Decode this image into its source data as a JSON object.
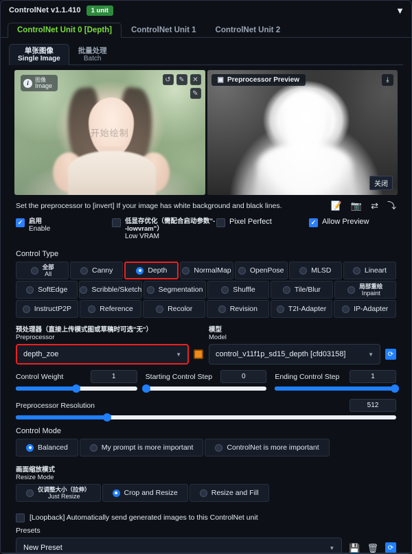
{
  "header": {
    "title": "ControlNet v1.1.410",
    "unit_badge": "1 unit",
    "collapse_icon": "▼"
  },
  "tabs": [
    {
      "label": "ControlNet Unit 0 [Depth]",
      "active": true
    },
    {
      "label": "ControlNet Unit 1",
      "active": false
    },
    {
      "label": "ControlNet Unit 2",
      "active": false
    }
  ],
  "subtabs": [
    {
      "cn": "单张图像",
      "en": "Single Image",
      "active": true
    },
    {
      "cn": "批量处理",
      "en": "Batch",
      "active": false
    }
  ],
  "image_panel": {
    "badge_cn": "图像",
    "badge_en": "Image",
    "info_icon": "i",
    "watermark": "开始绘制",
    "tools": [
      {
        "name": "undo-icon",
        "glyph": "↺"
      },
      {
        "name": "erase-icon",
        "glyph": "✎"
      },
      {
        "name": "close-icon",
        "glyph": "✕"
      }
    ],
    "edit_tool": {
      "name": "draw-icon",
      "glyph": "✎"
    }
  },
  "preview_panel": {
    "label": "Preprocessor Preview",
    "label_icon": "▣",
    "download_icon": "⤓",
    "close_label": "关闭"
  },
  "hint": {
    "text": "Set the preprocessor to [invert] If your image has white background and black lines.",
    "icons": [
      {
        "name": "edit-note-icon",
        "glyph": "📝"
      },
      {
        "name": "camera-icon",
        "glyph": "📷"
      },
      {
        "name": "swap-icon",
        "glyph": "⇄"
      },
      {
        "name": "send-arrow-icon",
        "glyph": "⤵"
      }
    ]
  },
  "checkboxes": {
    "enable": {
      "cn": "启用",
      "en": "Enable",
      "checked": true
    },
    "low_vram": {
      "cn": "低显存优化（需配合启动参数\"--lowvram\"）",
      "en": "Low VRAM",
      "checked": false
    },
    "pixel_perfect": {
      "label": "Pixel Perfect",
      "checked": false
    },
    "allow_preview": {
      "label": "Allow Preview",
      "checked": true
    }
  },
  "control_type": {
    "label": "Control Type",
    "rows": [
      [
        {
          "cn": "全部",
          "en": "All",
          "selected": false
        },
        {
          "label": "Canny",
          "selected": false
        },
        {
          "label": "Depth",
          "selected": true,
          "highlight": true
        },
        {
          "label": "NormalMap",
          "selected": false
        },
        {
          "label": "OpenPose",
          "selected": false
        },
        {
          "label": "MLSD",
          "selected": false
        },
        {
          "label": "Lineart",
          "selected": false
        }
      ],
      [
        {
          "label": "SoftEdge",
          "selected": false
        },
        {
          "label": "Scribble/Sketch",
          "selected": false
        },
        {
          "label": "Segmentation",
          "selected": false
        },
        {
          "label": "Shuffle",
          "selected": false
        },
        {
          "label": "Tile/Blur",
          "selected": false
        },
        {
          "cn": "局部重绘",
          "en": "Inpaint",
          "selected": false
        }
      ],
      [
        {
          "label": "InstructP2P",
          "selected": false
        },
        {
          "label": "Reference",
          "selected": false
        },
        {
          "label": "Recolor",
          "selected": false
        },
        {
          "label": "Revision",
          "selected": false
        },
        {
          "label": "T2I-Adapter",
          "selected": false
        },
        {
          "label": "IP-Adapter",
          "selected": false
        }
      ]
    ]
  },
  "preprocessor": {
    "label_cn": "预处理器（直接上传模式图或草稿时可选\"无\"）",
    "label_en": "Preprocessor",
    "value": "depth_zoe",
    "caret": "▼",
    "action_icon": "orange-square-icon"
  },
  "model": {
    "label_cn": "模型",
    "label_en": "Model",
    "value": "control_v11f1p_sd15_depth [cfd03158]",
    "caret": "▼",
    "refresh_icon": "⟳"
  },
  "sliders": [
    {
      "name": "Control Weight",
      "value": "1",
      "percent": 50
    },
    {
      "name": "Starting Control Step",
      "value": "0",
      "percent": 0
    },
    {
      "name": "Ending Control Step",
      "value": "1",
      "percent": 100
    }
  ],
  "resolution_slider": {
    "name": "Preprocessor Resolution",
    "value": "512",
    "percent": 24
  },
  "control_mode": {
    "label": "Control Mode",
    "options": [
      {
        "label": "Balanced",
        "selected": true
      },
      {
        "label": "My prompt is more important",
        "selected": false
      },
      {
        "label": "ControlNet is more important",
        "selected": false
      }
    ]
  },
  "resize_mode": {
    "label_cn": "画面缩放模式",
    "label_en": "Resize Mode",
    "options": [
      {
        "cn": "仅调整大小（拉伸）",
        "en": "Just Resize",
        "selected": false
      },
      {
        "label": "Crop and Resize",
        "selected": true
      },
      {
        "label": "Resize and Fill",
        "selected": false
      }
    ]
  },
  "loopback": {
    "label": "[Loopback] Automatically send generated images to this ControlNet unit",
    "checked": false
  },
  "presets": {
    "label": "Presets",
    "value": "New Preset",
    "caret": "▼",
    "save_icon": "💾",
    "delete_icon": "🗑",
    "refresh_icon": "⟳"
  },
  "colors": {
    "accent_blue": "#1f7fff",
    "accent_green": "#7bdc3a",
    "badge_green": "#2e8b3d",
    "highlight_red": "#ee2020",
    "orange": "#f08a1a"
  }
}
